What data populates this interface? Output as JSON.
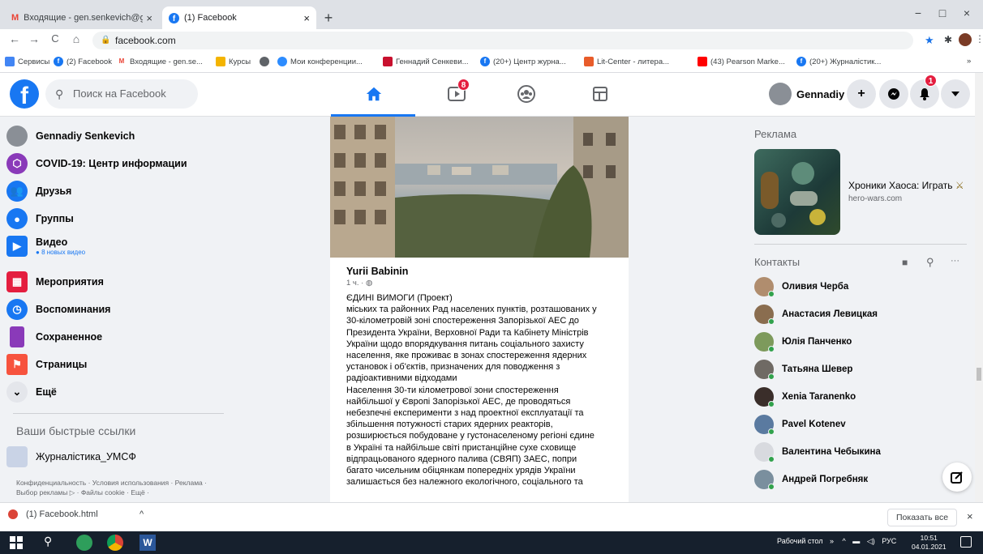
{
  "browser": {
    "tabs": [
      {
        "label": "Входящие - gen.senkevich@gm",
        "close": "×",
        "icon": "gmail-icon"
      },
      {
        "label": "(1) Facebook",
        "close": "×",
        "icon": "facebook-icon"
      }
    ],
    "new_tab": "+",
    "window_controls": {
      "minimize": "−",
      "maximize": "□",
      "close": "×"
    },
    "nav": {
      "back": "←",
      "forward": "→",
      "reload": "C",
      "home": "⌂"
    },
    "url": "facebook.com",
    "bookmarks": [
      {
        "label": "Сервисы",
        "color": "#4285f4"
      },
      {
        "label": "(2) Facebook",
        "color": "#1877f2"
      },
      {
        "label": "Входящие - gen.se...",
        "color": "#ea4335"
      },
      {
        "label": "Курсы",
        "color": "#f4b400"
      },
      {
        "label": "",
        "color": "#5f6368"
      },
      {
        "label": "Мои конференции...",
        "color": "#2d8cff"
      },
      {
        "label": "Геннадий Сенкеви...",
        "color": "#c8102e"
      },
      {
        "label": "(20+) Центр журна...",
        "color": "#1877f2"
      },
      {
        "label": "Lit-Center - литера...",
        "color": "#e85c2a"
      },
      {
        "label": "(43) Pearson Marke...",
        "color": "#ff0000"
      },
      {
        "label": "(20+) Журналістик...",
        "color": "#1877f2"
      }
    ],
    "bookmarks_more": "»"
  },
  "fb_header": {
    "logo": "f",
    "search_placeholder": "Поиск на Facebook",
    "watch_badge": "8",
    "profile_name": "Gennadiy",
    "notifications_badge": "1",
    "accent": "#1877f2"
  },
  "left_nav": {
    "items": [
      {
        "label": "Gennadiy Senkevich",
        "sub": "",
        "color": "#8a8f96",
        "icon": "avatar"
      },
      {
        "label": "COVID-19: Центр информации",
        "sub": "",
        "color": "#8a3ab9",
        "icon": "covid-info-icon"
      },
      {
        "label": "Друзья",
        "sub": "",
        "color": "#1877f2",
        "icon": "friends-icon"
      },
      {
        "label": "Группы",
        "sub": "",
        "color": "#1877f2",
        "icon": "groups-icon"
      },
      {
        "label": "Видео",
        "sub": "8 новых видео",
        "color": "#1877f2",
        "icon": "video-icon"
      },
      {
        "label": "Мероприятия",
        "sub": "",
        "color": "#e41e3f",
        "icon": "events-icon"
      },
      {
        "label": "Воспоминания",
        "sub": "",
        "color": "#1877f2",
        "icon": "memories-icon"
      },
      {
        "label": "Сохраненное",
        "sub": "",
        "color": "#8a3ab9",
        "icon": "saved-icon"
      },
      {
        "label": "Страницы",
        "sub": "",
        "color": "#f7533e",
        "icon": "pages-icon"
      },
      {
        "label": "Ещё",
        "sub": "",
        "color": "#e4e6eb",
        "icon": "chevron-down-icon"
      }
    ],
    "shortcuts_heading": "Ваши быстрые ссылки",
    "shortcut": "Журналістика_УМСФ",
    "footer": "Конфиденциальность · Условия использования · Реклама · Выбор рекламы ▷ · Файлы cookie · Ещё ·"
  },
  "post": {
    "author": "Yurii Babinin",
    "meta": "1 ч. · ",
    "lines": [
      "ЄДИНІ ВИМОГИ (Проект)",
      "міських та районних Рад населених пунктів, розташованих у",
      "30-кілометровій зоні спостереження Запорізької АЕС до",
      "Президента України, Верховної Ради та Кабінету Міністрів",
      "України щодо впорядкування питань соціального захисту",
      "населення, яке проживає в зонах спостереження ядерних",
      "установок і об'єктів, призначених для поводження з",
      "радіоактивними відходами",
      "Населення 30-ти кілометрової зони спостереження",
      "найбільшої у Європі Запорізької АЕС, де проводяться",
      "небезпечні експерименти з над проектної експлуатації та",
      "збільшення потужності старих ядерних реакторів,",
      "розширюється побудоване у густонаселеному регіоні єдине",
      "в Україні та найбільше світі пристанційне сухе сховище",
      "відпрацьованого ядерного палива (СВЯП) ЗАЕС, попри",
      "багато чисельним обіцянкам попередніх урядів України",
      "залишається без належного екологічного, соціального та"
    ]
  },
  "right_col": {
    "ad_heading": "Реклама",
    "ad_title": "Хроники Хаоса: Играть",
    "ad_url": "hero-wars.com",
    "contacts_heading": "Контакты",
    "contacts_more": "···",
    "contacts": [
      {
        "name": "Оливия Черба",
        "color": "#b08d6e"
      },
      {
        "name": "Анастасия Левицкая",
        "color": "#8a6d4f"
      },
      {
        "name": "Юлія Панченко",
        "color": "#7d9a5c"
      },
      {
        "name": "Татьяна Шевер",
        "color": "#6f6a64"
      },
      {
        "name": "Xenia Taranenko",
        "color": "#3a2e2a"
      },
      {
        "name": "Pavel Kotenev",
        "color": "#5a7aa0"
      },
      {
        "name": "Валентина Чебыкина",
        "color": "#d8dadf"
      },
      {
        "name": "Андрей Погребняк",
        "color": "#7a8f9e"
      }
    ]
  },
  "downloads": {
    "file": "(1) Facebook.html",
    "caret": "^",
    "show_all": "Показать все",
    "close": "×"
  },
  "taskbar": {
    "desktop": "Рабочий стол",
    "tray_more": "»",
    "lang": "РУС",
    "time": "10:51",
    "date": "04.01.2021"
  }
}
